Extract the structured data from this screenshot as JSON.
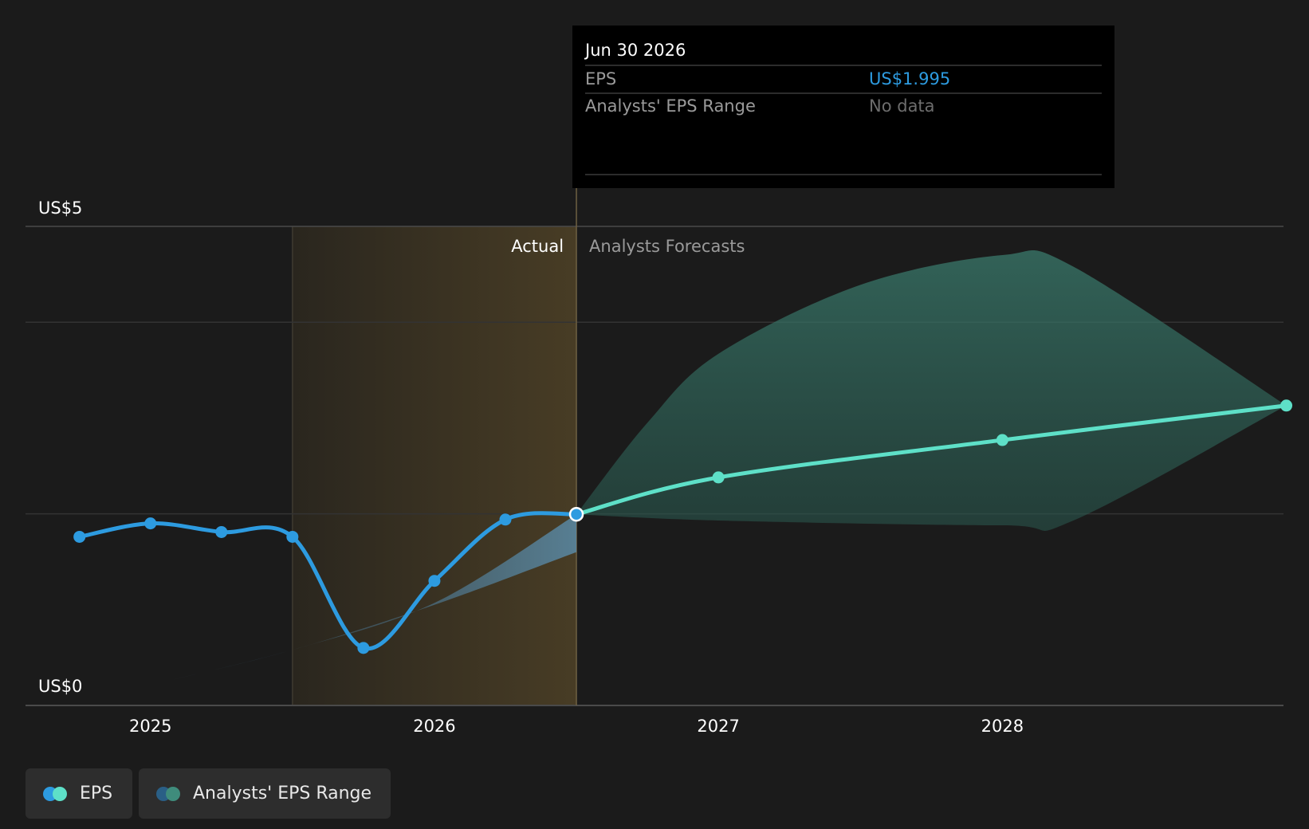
{
  "chart_data": {
    "type": "line",
    "y_axis": {
      "label_top": "US$5",
      "label_bottom": "US$0",
      "ylim": [
        0,
        5
      ]
    },
    "x_ticks": [
      2025,
      2026,
      2027,
      2028
    ],
    "xlim": [
      2024.56,
      2028.99
    ],
    "divider_x": 2026.5,
    "shaded_from": 2025.5,
    "section_labels": {
      "actual": "Actual",
      "forecast": "Analysts Forecasts"
    },
    "series": [
      {
        "name": "EPS",
        "segment": "actual",
        "color": "#2d9be0",
        "points": [
          [
            2024.75,
            1.76
          ],
          [
            2025.0,
            1.9
          ],
          [
            2025.25,
            1.81
          ],
          [
            2025.5,
            1.76
          ],
          [
            2025.75,
            0.6
          ],
          [
            2026.0,
            1.3
          ],
          [
            2026.25,
            1.94
          ],
          [
            2026.5,
            1.995
          ]
        ]
      },
      {
        "name": "EPS",
        "segment": "forecast",
        "color": "#5ee0c8",
        "points": [
          [
            2026.5,
            1.995
          ],
          [
            2027.0,
            2.38
          ],
          [
            2028.0,
            2.77
          ],
          [
            2029.0,
            3.13
          ]
        ]
      }
    ],
    "range_bands": [
      {
        "name": "Analysts' EPS Range",
        "segment": "actual",
        "color": "#4d7590",
        "low": [
          [
            2025.08,
            0.27
          ],
          [
            2025.5,
            0.58
          ],
          [
            2026.0,
            1.05
          ],
          [
            2026.5,
            1.6
          ]
        ],
        "high": [
          [
            2025.08,
            0.27
          ],
          [
            2025.5,
            0.58
          ],
          [
            2026.0,
            1.07
          ],
          [
            2026.5,
            1.995
          ]
        ]
      },
      {
        "name": "Analysts' EPS Range",
        "segment": "forecast",
        "color": "#2f5750",
        "low": [
          [
            2026.5,
            1.995
          ],
          [
            2027.0,
            1.93
          ],
          [
            2028.0,
            1.88
          ],
          [
            2028.25,
            1.93
          ],
          [
            2029.0,
            3.13
          ]
        ],
        "high": [
          [
            2026.5,
            1.995
          ],
          [
            2026.75,
            2.95
          ],
          [
            2027.0,
            3.67
          ],
          [
            2027.5,
            4.39
          ],
          [
            2028.0,
            4.7
          ],
          [
            2028.25,
            4.58
          ],
          [
            2029.0,
            3.13
          ]
        ]
      }
    ],
    "tooltip": {
      "date": "Jun 30 2026",
      "rows": [
        {
          "label": "EPS",
          "value": "US$1.995",
          "value_color": "#2d9be0"
        },
        {
          "label": "Analysts' EPS Range",
          "value": "No data",
          "value_color": "#6d6d6d"
        }
      ]
    },
    "legend": [
      {
        "label": "EPS",
        "colors": [
          "#2d9be0",
          "#5ee0c8"
        ]
      },
      {
        "label": "Analysts' EPS Range",
        "colors": [
          "#2a5f86",
          "#3f8c7c"
        ]
      }
    ]
  }
}
